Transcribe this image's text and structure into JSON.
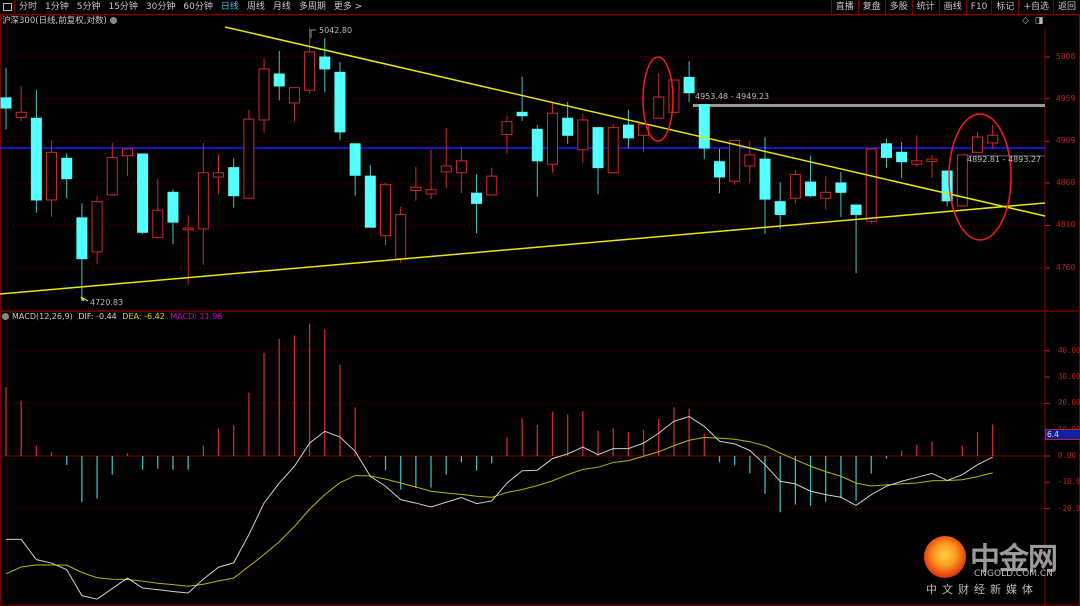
{
  "toolbar": {
    "periods": [
      "分时",
      "1分钟",
      "5分钟",
      "15分钟",
      "30分钟",
      "60分钟",
      "日线",
      "周线",
      "月线",
      "多周期",
      "更多 >"
    ],
    "active_period": "日线",
    "buttons": [
      "直播",
      "复盘",
      "多股",
      "统计",
      "画线",
      "F10",
      "标记",
      "+自选",
      "返回"
    ]
  },
  "title": "沪深300(日线,前复权,对数)",
  "price_axis": [
    "5008",
    "4959",
    "4909",
    "4860",
    "4810",
    "4760"
  ],
  "annotations": {
    "high_label": "5042.80",
    "low_label": "4720.83",
    "resistance_label": "4953.48 - 4949.23",
    "gap_label": "4892.81 - 4893.27"
  },
  "macd_header": {
    "name": "MACD(12,26,9)",
    "dif": "DIF: -0.44",
    "dea": "DEA: -6.42",
    "macd": "MACD: 11.96"
  },
  "macd_axis": [
    "40.00",
    "30.00",
    "20.00",
    "10.00",
    "0.00",
    "-10.00",
    "-20.00"
  ],
  "cursor_value": "6.4",
  "logo": {
    "cn": "中金网",
    "en": "CNGOLD.COM.CN",
    "slogan": "中文财经新媒体"
  },
  "colors": {
    "up": "#d02828",
    "down": "#54ffff",
    "trend": "#e8e800",
    "hline": "#1a1aff",
    "dea": "#b8b800",
    "dif": "#d0d0d0"
  },
  "chart_data": {
    "type": "candlestick",
    "title": "沪深300(日线,前复权,对数)",
    "ylim": [
      4700,
      5060
    ],
    "ohlc": [
      [
        4960,
        4995,
        4923,
        4948
      ],
      [
        4937,
        4974,
        4933,
        4943
      ],
      [
        4936,
        4969,
        4825,
        4840
      ],
      [
        4840,
        4910,
        4820,
        4896
      ],
      [
        4889,
        4895,
        4842,
        4865
      ],
      [
        4819,
        4836,
        4721,
        4771
      ],
      [
        4779,
        4845,
        4765,
        4838
      ],
      [
        4846,
        4907,
        4845,
        4890
      ],
      [
        4892,
        4900,
        4868,
        4900
      ],
      [
        4894,
        4894,
        4800,
        4802
      ],
      [
        4796,
        4865,
        4795,
        4828
      ],
      [
        4849,
        4852,
        4788,
        4814
      ],
      [
        4805,
        4822,
        4740,
        4807
      ],
      [
        4806,
        4907,
        4764,
        4872
      ],
      [
        4867,
        4894,
        4847,
        4872
      ],
      [
        4878,
        4889,
        4831,
        4845
      ],
      [
        4842,
        4946,
        4841,
        4935
      ],
      [
        4934,
        5006,
        4919,
        4994
      ],
      [
        4988,
        5015,
        4957,
        4974
      ],
      [
        4954,
        4972,
        4932,
        4972
      ],
      [
        4969,
        5043,
        4965,
        5014
      ],
      [
        5008,
        5030,
        4967,
        4994
      ],
      [
        4990,
        5002,
        4910,
        4920
      ],
      [
        4906,
        4906,
        4845,
        4869
      ],
      [
        4868,
        4881,
        4808,
        4808
      ],
      [
        4798,
        4860,
        4787,
        4858
      ],
      [
        4771,
        4832,
        4766,
        4823
      ],
      [
        4851,
        4879,
        4839,
        4855
      ],
      [
        4847,
        4899,
        4841,
        4852
      ],
      [
        4873,
        4925,
        4854,
        4880
      ],
      [
        4872,
        4903,
        4848,
        4886
      ],
      [
        4848,
        4870,
        4801,
        4836
      ],
      [
        4846,
        4878,
        4846,
        4868
      ],
      [
        4917,
        4939,
        4894,
        4932
      ],
      [
        4943,
        4985,
        4933,
        4939
      ],
      [
        4923,
        4928,
        4844,
        4886
      ],
      [
        4882,
        4954,
        4872,
        4942
      ],
      [
        4936,
        4955,
        4906,
        4916
      ],
      [
        4899,
        4941,
        4883,
        4934
      ],
      [
        4925,
        4925,
        4847,
        4878
      ],
      [
        4872,
        4929,
        4872,
        4925
      ],
      [
        4928,
        4946,
        4901,
        4913
      ],
      [
        4916,
        4929,
        4896,
        4929
      ],
      [
        4936,
        4989,
        4936,
        4961
      ],
      [
        4943,
        4981,
        4943,
        4981
      ],
      [
        4984,
        5003,
        4955,
        4966
      ],
      [
        4952,
        4952,
        4888,
        4901
      ],
      [
        4885,
        4900,
        4848,
        4867
      ],
      [
        4862,
        4910,
        4858,
        4910
      ],
      [
        4880,
        4909,
        4860,
        4893
      ],
      [
        4888,
        4914,
        4800,
        4841
      ],
      [
        4838,
        4861,
        4806,
        4823
      ],
      [
        4842,
        4875,
        4836,
        4870
      ],
      [
        4861,
        4892,
        4843,
        4845
      ],
      [
        4842,
        4868,
        4829,
        4849
      ],
      [
        4860,
        4873,
        4820,
        4849
      ],
      [
        4834,
        4834,
        4754,
        4823
      ],
      [
        4815,
        4900,
        4812,
        4900
      ],
      [
        4906,
        4912,
        4878,
        4890
      ],
      [
        4896,
        4908,
        4866,
        4885
      ],
      [
        4882,
        4916,
        4879,
        4886
      ],
      [
        4885,
        4893,
        4866,
        4888
      ],
      [
        4874,
        4874,
        4833,
        4839
      ],
      [
        4833,
        4893,
        4832,
        4893
      ],
      [
        4896,
        4920,
        4896,
        4914
      ],
      [
        4907,
        4928,
        4900,
        4916
      ]
    ],
    "horizontal_line": 4901,
    "resistance_line": 4951,
    "gap_line": 4893,
    "macd": {
      "ylim": [
        -58,
        55
      ],
      "dif": [
        -31.7,
        -31.7,
        -39.4,
        -40.7,
        -43.2,
        -53.1,
        -54.4,
        -50.4,
        -46.4,
        -50.2,
        -50.8,
        -51.5,
        -52.1,
        -46.8,
        -42.3,
        -40.6,
        -29.9,
        -17.9,
        -10.3,
        -3.9,
        4.9,
        9.4,
        7.2,
        1.8,
        -7.7,
        -11.5,
        -16.6,
        -17.9,
        -19.4,
        -17.6,
        -15.8,
        -18.1,
        -17.1,
        -10.3,
        -5.6,
        -5.4,
        -1,
        0.8,
        3.4,
        0.5,
        2.8,
        2.8,
        4.9,
        8.7,
        13.2,
        15,
        11.3,
        5.6,
        4.6,
        2.1,
        -3.3,
        -9.6,
        -10.6,
        -13.4,
        -14.7,
        -15.7,
        -18.8,
        -14.7,
        -11.5,
        -9.6,
        -8.1,
        -6.6,
        -9.3,
        -7.1,
        -3.3,
        -0.44
      ],
      "hist": [
        26.2,
        21,
        4,
        1.5,
        -3.4,
        -17.6,
        -16.2,
        -7.1,
        1.1,
        -5.2,
        -4.8,
        -5.2,
        -5.2,
        3.9,
        10.4,
        11.7,
        24.1,
        39.2,
        44.6,
        45.8,
        50.3,
        48.2,
        34.7,
        18.5,
        -0.3,
        -5.4,
        -12.7,
        -12.2,
        -12,
        -7.1,
        -2.4,
        -5.6,
        -2.8,
        7.1,
        14.3,
        11.7,
        16.9,
        15.8,
        17,
        9.6,
        10.5,
        9.1,
        10,
        14.2,
        18.5,
        18,
        8.5,
        -2.4,
        -3.5,
        -6.6,
        -14.4,
        -21.4,
        -18.5,
        -19,
        -17.5,
        -16,
        -17,
        -6.6,
        -1,
        2,
        4.3,
        5.6,
        0,
        3.9,
        9.1,
        11.96
      ]
    }
  }
}
